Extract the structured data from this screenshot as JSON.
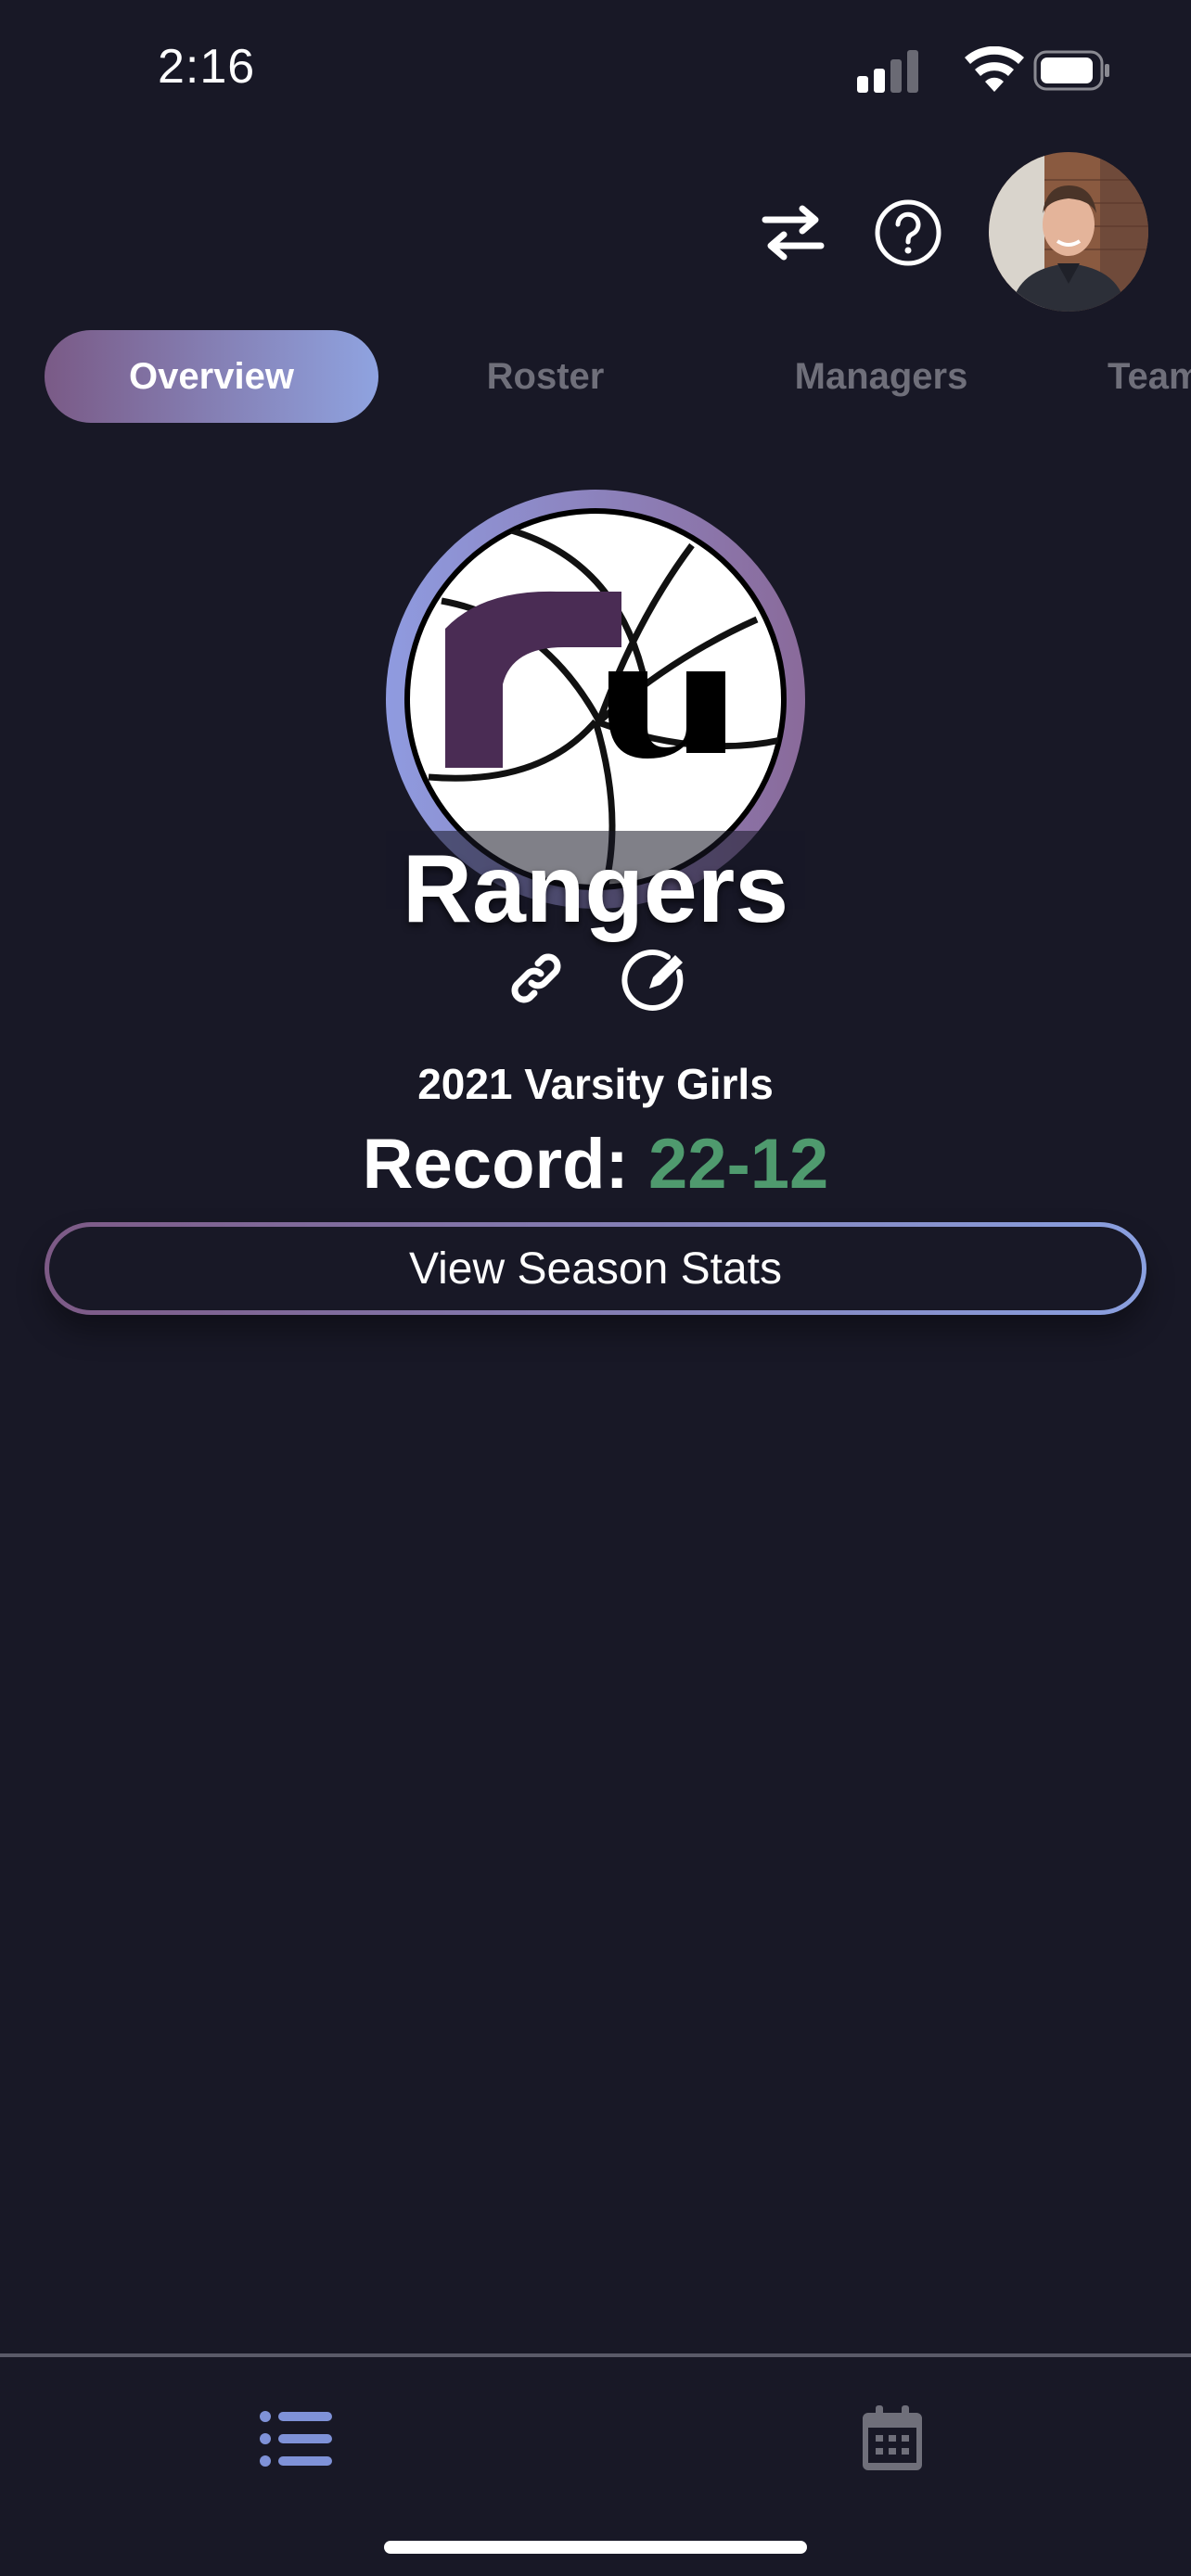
{
  "status_bar": {
    "time": "2:16"
  },
  "header": {
    "swap_icon": "swap-arrows-icon",
    "help_icon": "question-circle-icon",
    "avatar_icon": "user-avatar"
  },
  "tabs": [
    {
      "label": "Overview",
      "active": true
    },
    {
      "label": "Roster",
      "active": false
    },
    {
      "label": "Managers",
      "active": false
    },
    {
      "label": "Team",
      "active": false
    }
  ],
  "team": {
    "logo_text": "ru",
    "name": "Rangers",
    "link_icon": "link-icon",
    "edit_icon": "edit-icon",
    "season": "2021 Varsity Girls",
    "record_label": "Record:",
    "record_value": "22-12",
    "stats_button_label": "View Season Stats"
  },
  "colors": {
    "background": "#181826",
    "accent_purple": "#7a5a86",
    "accent_blue": "#8fa3e0",
    "record_green": "#4f9a6e",
    "inactive_tab": "#6f6f7a"
  },
  "bottom_nav": {
    "items": [
      {
        "icon": "list-icon",
        "active": true
      },
      {
        "icon": "calendar-icon",
        "active": false
      }
    ]
  }
}
